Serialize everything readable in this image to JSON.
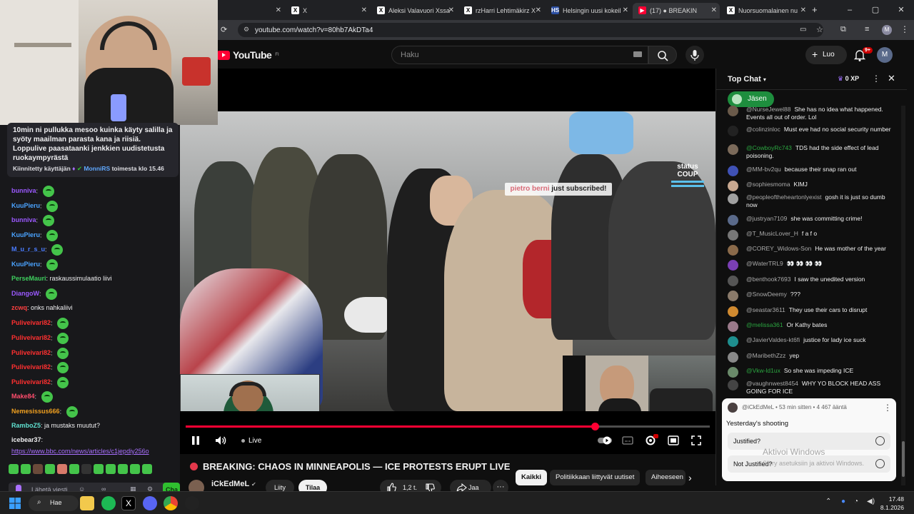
{
  "browser": {
    "tabs": [
      {
        "label": "",
        "icon": "",
        "active": false
      },
      {
        "label": "X",
        "icon": "X",
        "active": false
      },
      {
        "label": "Aleksi Valavuori Xssa",
        "icon": "X",
        "active": false
      },
      {
        "label": "rzHarri Lehtimäkirz X",
        "icon": "X",
        "active": false
      },
      {
        "label": "Helsingin uusi kokeil",
        "icon": "HS",
        "active": false
      },
      {
        "label": "(17) ● BREAKIN",
        "icon": "YT",
        "active": true
      },
      {
        "label": "Nuorsuomalainen nu",
        "icon": "X",
        "active": false
      }
    ],
    "new_tab": "+",
    "url": "youtube.com/watch?v=80hb7AkDTa4",
    "profile_initial": "M",
    "window_controls": [
      "–",
      "▢",
      "✕"
    ]
  },
  "twitch": {
    "pinned_message": "10min ni pullukka mesoo kuinka käyty salilla ja syöty maailman parasta kana ja riisiä. Loppulive paasataanki jenkkien uudistetusta ruokaympyrästä",
    "pinned_by_prefix": "Kiinnitetty käyttäjän",
    "pinned_by_user": "MonniRS",
    "pinned_by_suffix": "toimesta klo 15.46",
    "messages": [
      {
        "user": "bunniva",
        "text": "",
        "emote": true,
        "color": "#9b59ff"
      },
      {
        "user": "KuuPieru",
        "text": "",
        "emote": true,
        "color": "#4aa3ff"
      },
      {
        "user": "bunniva",
        "text": "",
        "emote": true,
        "color": "#9b59ff"
      },
      {
        "user": "KuuPieru",
        "text": "",
        "emote": true,
        "color": "#4aa3ff"
      },
      {
        "user": "M_u_r_s_u",
        "text": "",
        "emote": true,
        "color": "#4a7cff"
      },
      {
        "user": "KuuPieru",
        "text": "",
        "emote": true,
        "color": "#4aa3ff"
      },
      {
        "user": "PerseMauri",
        "text": "raskaussimulaatio liivi",
        "emote": false,
        "color": "#3ecf5e"
      },
      {
        "user": "DiangoW",
        "text": "",
        "emote": true,
        "color": "#9b59ff"
      },
      {
        "user": "zcwq",
        "text": "onks nahkaliivi",
        "emote": false,
        "color": "#ff4040"
      },
      {
        "user": "Puliveivari82",
        "text": "",
        "emote": true,
        "color": "#ff3030"
      },
      {
        "user": "Puliveivari82",
        "text": "",
        "emote": true,
        "color": "#ff3030"
      },
      {
        "user": "Puliveivari82",
        "text": "",
        "emote": true,
        "color": "#ff3030"
      },
      {
        "user": "Puliveivari82",
        "text": "",
        "emote": true,
        "color": "#ff3030"
      },
      {
        "user": "Puliveivari82",
        "text": "",
        "emote": true,
        "color": "#ff3030"
      },
      {
        "user": "Make84",
        "text": "",
        "emote": true,
        "color": "#ff4d6d"
      },
      {
        "user": "Nemesissus666",
        "text": "",
        "emote": true,
        "color": "#f0a020"
      },
      {
        "user": "RamboZ5",
        "text": "ja mustaks muutut?",
        "emote": false,
        "color": "#5fe0d0"
      },
      {
        "user": "icebear37",
        "text": "",
        "emote": false,
        "color": "#efeff1"
      }
    ],
    "link": "https://www.bbc.com/news/articles/c1jepdiy256o",
    "send_placeholder": "Lähetä viesti",
    "chat_button": "Cha"
  },
  "youtube": {
    "logo_text": "YouTube",
    "logo_region": "FI",
    "search_placeholder": "Haku",
    "create_label": "Luo",
    "notif_count": "9+",
    "avatar_initial": "M",
    "video": {
      "subscriber_banner_name": "pietro berni",
      "subscriber_banner_text": "just subscribed!",
      "overlay_logo": "status COUP",
      "live_label": "Live",
      "progress": 0.78,
      "title": "BREAKING: CHAOS IN MINNEAPOLIS — ICE PROTESTS ERUPT LIVE",
      "channel": "iCkEdMeL",
      "join_label": "Liity",
      "subscribe_label": "Tilaa",
      "likes": "1,2 t.",
      "share_label": "Jaa",
      "more_label": "···"
    },
    "chips": [
      "Kaikki",
      "Politiikkaan liittyvät uutiset",
      "Aiheeseen"
    ],
    "live_chat": {
      "header": "Top Chat",
      "xp": "0 XP",
      "member_chip": "Jäsen",
      "messages": [
        {
          "author": "@NurseJewel88",
          "text": "She has no idea what happened. Events all out of order. Lol",
          "green": false,
          "avatar_color": "#6a5a4a"
        },
        {
          "author": "@colinzinloc",
          "text": "Must eve had no social security number",
          "green": false,
          "avatar_color": "#222"
        },
        {
          "author": "@CowboyRc743",
          "text": "TDS had the side effect of lead poisoning.",
          "green": true,
          "avatar_color": "#7b6a5a"
        },
        {
          "author": "@MM-bv2qu",
          "text": "because their snap ran out",
          "green": false,
          "avatar_color": "#3f51b5"
        },
        {
          "author": "@sophiesmoma",
          "text": "KIMJ",
          "green": false,
          "avatar_color": "#c8a890"
        },
        {
          "author": "@peopleoftheheartonlyexist",
          "text": "gosh it is just so dumb now",
          "green": false,
          "avatar_color": "#a0a0a0"
        },
        {
          "author": "@justryan7109",
          "text": "she was committing crime!",
          "green": false,
          "avatar_color": "#5a6a8a"
        },
        {
          "author": "@T_MusicLover_H",
          "text": "f a f o",
          "green": false,
          "avatar_color": "#777"
        },
        {
          "author": "@COREY_Widows-Son",
          "text": "He was mother of the year",
          "green": false,
          "avatar_color": "#8a6a4a"
        },
        {
          "author": "@WaterTRL9",
          "text": "👀 👀 👀 👀",
          "green": false,
          "avatar_color": "#7b3fb5"
        },
        {
          "author": "@benthook7693",
          "text": "I saw the unedited version",
          "green": false,
          "avatar_color": "#555"
        },
        {
          "author": "@SnowDeemy",
          "text": "???",
          "green": false,
          "avatar_color": "#8a7a6a"
        },
        {
          "author": "@seastar3611",
          "text": "They use their cars to disrupt",
          "green": false,
          "avatar_color": "#d08a30"
        },
        {
          "author": "@melissa361",
          "text": "Or Kathy bates",
          "green": true,
          "avatar_color": "#9a7a8a"
        },
        {
          "author": "@JavierValdes-kt6fi",
          "text": "justice for lady ice suck",
          "green": false,
          "avatar_color": "#1e8e8e"
        },
        {
          "author": "@MaribethZzz",
          "text": "yep",
          "green": false,
          "avatar_color": "#888"
        },
        {
          "author": "@Vkw-ld1ux",
          "text": "So she was impeding ICE",
          "green": true,
          "avatar_color": "#6a8a6a"
        },
        {
          "author": "@vaughnwest8454",
          "text": "WHY YO BLOCK HEAD ASS GOING FOR ICE",
          "green": false,
          "avatar_color": "#444"
        }
      ],
      "poll": {
        "header": "@iCkEdMeL • 53 min sitten • 4 467 ääntä",
        "question": "Yesterday's shooting",
        "options": [
          "Justified?",
          "Not Justified?"
        ]
      }
    }
  },
  "windows": {
    "activate_title": "Aktivoi Windows",
    "activate_sub": "Siirry asetuksiin ja aktivoi Windows.",
    "search_label": "Hae",
    "time": "17.48",
    "date": "8.1.2026"
  },
  "colors": {
    "yt_red": "#ff0033",
    "twitch_green": "#44c44a",
    "poll_bg": "#f9f9f9"
  }
}
